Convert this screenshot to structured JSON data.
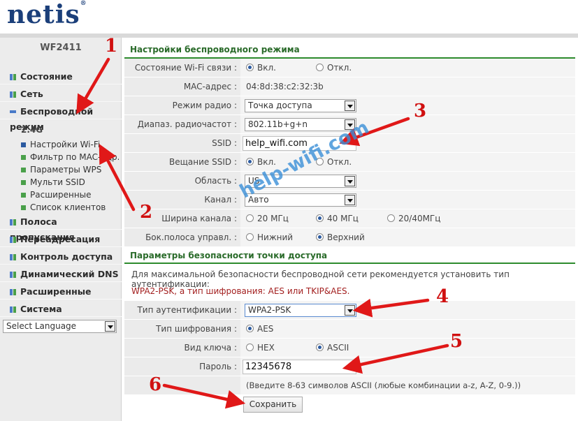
{
  "brand": {
    "logo": "netis",
    "reg": "®"
  },
  "sidebar": {
    "model": "WF2411",
    "items": [
      {
        "label": "Состояние"
      },
      {
        "label": "Сеть"
      },
      {
        "label": "Беспроводной режим"
      },
      {
        "label": "Полоса пропускания"
      },
      {
        "label": "Переадресация"
      },
      {
        "label": "Контроль доступа"
      },
      {
        "label": "Динамический DNS"
      },
      {
        "label": "Расширенные"
      },
      {
        "label": "Система"
      }
    ],
    "band": "2.4G",
    "subitems": [
      {
        "label": "Настройки Wi-Fi"
      },
      {
        "label": "Фильтр по MAC-адр."
      },
      {
        "label": "Параметры WPS"
      },
      {
        "label": "Мульти SSID"
      },
      {
        "label": "Расширенные"
      },
      {
        "label": "Список клиентов"
      }
    ],
    "language": "Select Language"
  },
  "wireless": {
    "title": "Настройки беспроводного режима",
    "wifi_status_label": "Состояние Wi-Fi связи :",
    "on": "Вкл.",
    "off": "Откл.",
    "mac_label": "MAC-адрес :",
    "mac_value": "04:8d:38:c2:32:3b",
    "radio_mode_label": "Режим радио :",
    "radio_mode_value": "Точка доступа",
    "band_label": "Диапаз. радиочастот :",
    "band_value": "802.11b+g+n",
    "ssid_label": "SSID :",
    "ssid_value": "help_wifi.com",
    "broadcast_label": "Вещание SSID :",
    "region_label": "Область :",
    "region_value": "US",
    "channel_label": "Канал :",
    "channel_value": "Авто",
    "width_label": "Ширина канала :",
    "width_20": "20 МГц",
    "width_40": "40 МГц",
    "width_2040": "20/40МГц",
    "sideband_label": "Бок.полоса управл. :",
    "sideband_low": "Нижний",
    "sideband_high": "Верхний"
  },
  "security": {
    "title": "Параметры безопасности точки доступа",
    "note_line1": "Для максимальной безопасности беспроводной сети рекомендуется установить тип аутентификации:",
    "note_line2": "WPA2-PSK, а тип шифрования: AES или TKIP&AES.",
    "auth_label": "Тип аутентификации :",
    "auth_value": "WPA2-PSK",
    "enc_label": "Тип шифрования :",
    "enc_value": "AES",
    "key_label": "Вид ключа :",
    "key_hex": "HEX",
    "key_ascii": "ASCII",
    "password_label": "Пароль :",
    "password_value": "12345678",
    "hint": "(Введите 8-63 символов ASCII (любые комбинации a-z, A-Z, 0-9.))",
    "save": "Сохранить"
  },
  "annotations": {
    "n1": "1",
    "n2": "2",
    "n3": "3",
    "n4": "4",
    "n5": "5",
    "n6": "6",
    "watermark": "help-wifi.com",
    "arrow_color": "#e01818"
  }
}
